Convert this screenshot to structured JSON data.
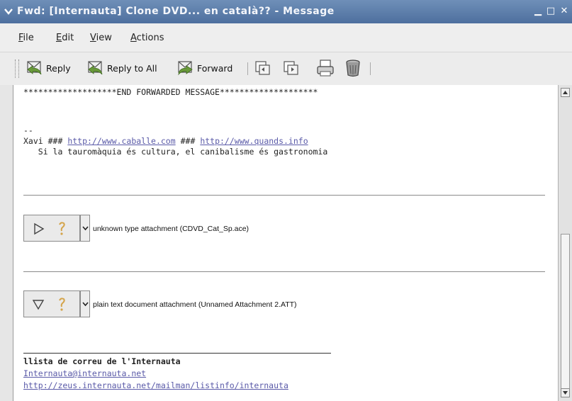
{
  "window": {
    "title": "Fwd: [Internauta]  Clone DVD... en català?? - Message",
    "controls": {
      "minimize": "▁",
      "maximize": "□",
      "close": "✕"
    }
  },
  "menu": {
    "file": "File",
    "edit": "Edit",
    "view": "View",
    "actions": "Actions"
  },
  "toolbar": {
    "reply": "Reply",
    "reply_all": "Reply to All",
    "forward": "Forward"
  },
  "message": {
    "end_forwarded": "*******************END FORWARDED MESSAGE********************",
    "sig_dashes": "--",
    "sig_name": "Xavi ###",
    "sig_link1": "http://www.caballe.com",
    "sig_sep": "###",
    "sig_link2": "http://www.quands.info",
    "sig_quote": "   Si la tauromàquia és cultura, el canibalisme és gastronomia",
    "attachment1_label": "unknown type attachment (CDVD_Cat_Sp.ace)",
    "attachment2_label": "plain text document attachment (Unnamed Attachment 2.ATT)",
    "list_name": "llista de correu de l'Internauta",
    "list_email": "Internauta@internauta.net",
    "list_url": "http://zeus.internauta.net/mailman/listinfo/internauta"
  },
  "colors": {
    "titlebar": "#5a7aa8",
    "link": "#5a5aa8"
  }
}
